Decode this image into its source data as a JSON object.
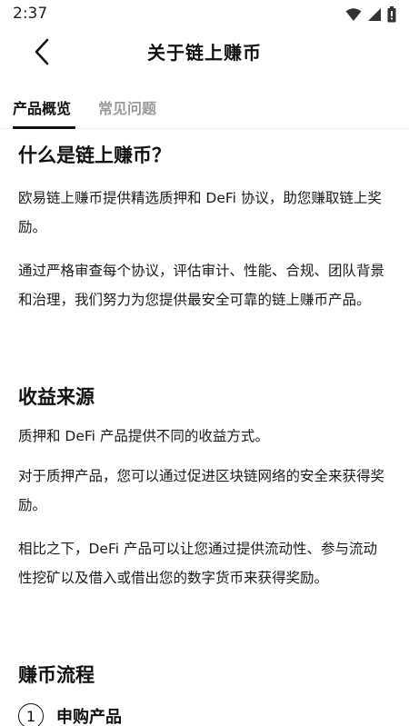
{
  "status_bar": {
    "time": "2:37"
  },
  "header": {
    "title": "关于链上赚币"
  },
  "tabs": [
    {
      "label": "产品概览",
      "active": true
    },
    {
      "label": "常见问题",
      "active": false
    }
  ],
  "sections": {
    "what": {
      "title": "什么是链上赚币？",
      "p1": "欧易链上赚币提供精选质押和 DeFi 协议，助您赚取链上奖励。",
      "p2": "通过严格审查每个协议，评估审计、性能、合规、团队背景和治理，我们努力为您提供最安全可靠的链上赚币产品。"
    },
    "yield": {
      "title": "收益来源",
      "p1": "质押和 DeFi 产品提供不同的收益方式。",
      "p2": "对于质押产品，您可以通过促进区块链网络的安全来获得奖励。",
      "p3": "相比之下，DeFi 产品可以让您通过提供流动性、参与流动性挖矿以及借入或借出您的数字货币来获得奖励。"
    },
    "flow": {
      "title": "赚币流程",
      "steps": [
        {
          "number": "1",
          "label": "申购产品"
        }
      ]
    }
  },
  "colors": {
    "text": "#111111",
    "inactive_tab": "#9a9a9a",
    "divider": "#eeeeee"
  }
}
